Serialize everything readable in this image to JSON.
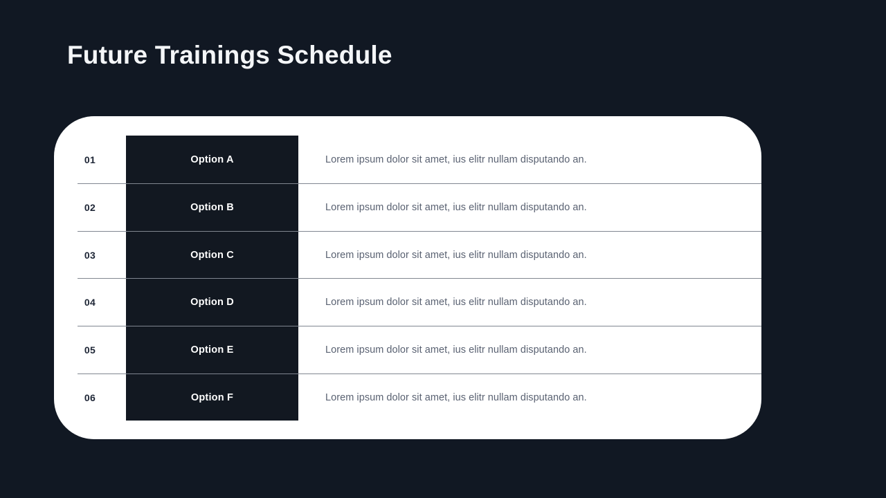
{
  "slide": {
    "title": "Future Trainings Schedule",
    "background_color": "#111823",
    "card_color": "#ffffff",
    "option_box_color": "#121821",
    "divider_color": "#808690",
    "number_color": "#1d2535",
    "option_text_color": "#ffffff",
    "description_color": "#5a6272",
    "title_color": "#f4f6f8"
  },
  "table": {
    "rows": [
      {
        "number": "01",
        "option": "Option A",
        "description": "Lorem ipsum dolor sit amet, ius elitr nullam disputando an."
      },
      {
        "number": "02",
        "option": "Option B",
        "description": "Lorem ipsum dolor sit amet, ius elitr nullam disputando an."
      },
      {
        "number": "03",
        "option": "Option C",
        "description": "Lorem ipsum dolor sit amet, ius elitr nullam disputando an."
      },
      {
        "number": "04",
        "option": "Option D",
        "description": "Lorem ipsum dolor sit amet, ius elitr nullam disputando an."
      },
      {
        "number": "05",
        "option": "Option E",
        "description": "Lorem ipsum dolor sit amet, ius elitr nullam disputando an."
      },
      {
        "number": "06",
        "option": "Option F",
        "description": "Lorem ipsum dolor sit amet, ius elitr nullam disputando an."
      }
    ]
  }
}
